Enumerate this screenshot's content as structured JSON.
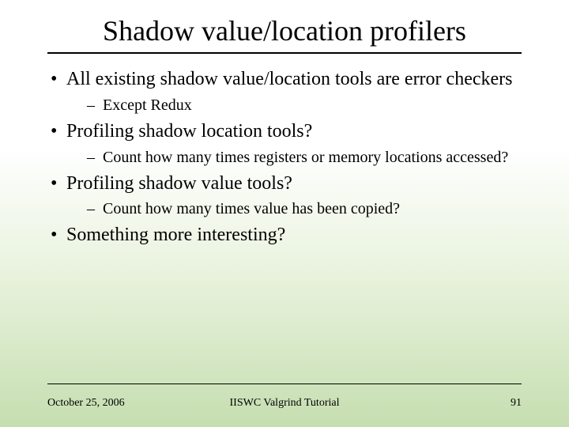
{
  "title": "Shadow value/location profilers",
  "bullets": [
    {
      "text": "All existing shadow value/location tools are error checkers",
      "sub": [
        {
          "text": "Except Redux"
        }
      ]
    },
    {
      "text": "Profiling shadow location tools?",
      "sub": [
        {
          "text": "Count how many times registers or memory locations accessed?"
        }
      ]
    },
    {
      "text": "Profiling shadow value tools?",
      "sub": [
        {
          "text": "Count how many times value has been copied?"
        }
      ]
    },
    {
      "text": "Something more interesting?",
      "sub": []
    }
  ],
  "footer": {
    "date": "October 25, 2006",
    "center": "IISWC Valgrind Tutorial",
    "page": "91"
  }
}
